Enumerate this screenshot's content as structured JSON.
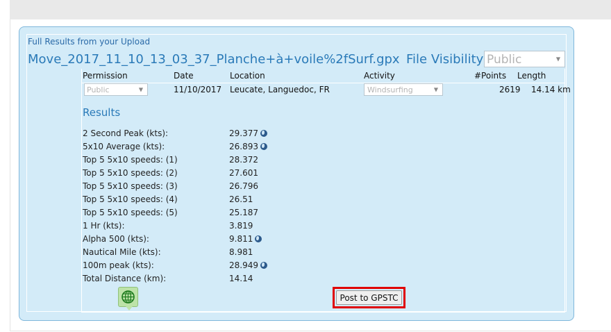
{
  "panel": {
    "title": "Full Results from your Upload",
    "file_name": "Move_2017_11_10_13_03_37_Planche+à+voile%2fSurf.gpx",
    "visibility_label": "File Visibility:",
    "visibility_value": "Public"
  },
  "table": {
    "headers": [
      "Permission",
      "Date",
      "Location",
      "Activity",
      "#Points",
      "Length"
    ],
    "row": {
      "permission": "Public",
      "date": "11/10/2017",
      "location": "Leucate, Languedoc, FR",
      "activity": "Windsurfing",
      "points": "2619",
      "length": "14.14 km"
    }
  },
  "results": {
    "heading": "Results",
    "rows": [
      {
        "label": "2 Second Peak (kts):",
        "value": "29.377",
        "has_globe": true
      },
      {
        "label": "5x10 Average (kts):",
        "value": "26.893",
        "has_globe": true
      },
      {
        "label": "Top 5 5x10 speeds: (1)",
        "value": "28.372",
        "has_globe": false
      },
      {
        "label": "Top 5 5x10 speeds: (2)",
        "value": "27.601",
        "has_globe": false
      },
      {
        "label": "Top 5 5x10 speeds: (3)",
        "value": "26.796",
        "has_globe": false
      },
      {
        "label": "Top 5 5x10 speeds: (4)",
        "value": "26.51",
        "has_globe": false
      },
      {
        "label": "Top 5 5x10 speeds: (5)",
        "value": "25.187",
        "has_globe": false
      },
      {
        "label": "1 Hr (kts):",
        "value": "3.819",
        "has_globe": false
      },
      {
        "label": "Alpha 500 (kts):",
        "value": "9.811",
        "has_globe": true
      },
      {
        "label": "Nautical Mile (kts):",
        "value": "8.981",
        "has_globe": false
      },
      {
        "label": "100m peak (kts):",
        "value": "28.949",
        "has_globe": true
      },
      {
        "label": "Total Distance (km):",
        "value": "14.14",
        "has_globe": false
      }
    ]
  },
  "actions": {
    "map_icon": "globe-map-icon",
    "post_label": "Post to GPSTC",
    "highlight_color": "#e00000"
  }
}
